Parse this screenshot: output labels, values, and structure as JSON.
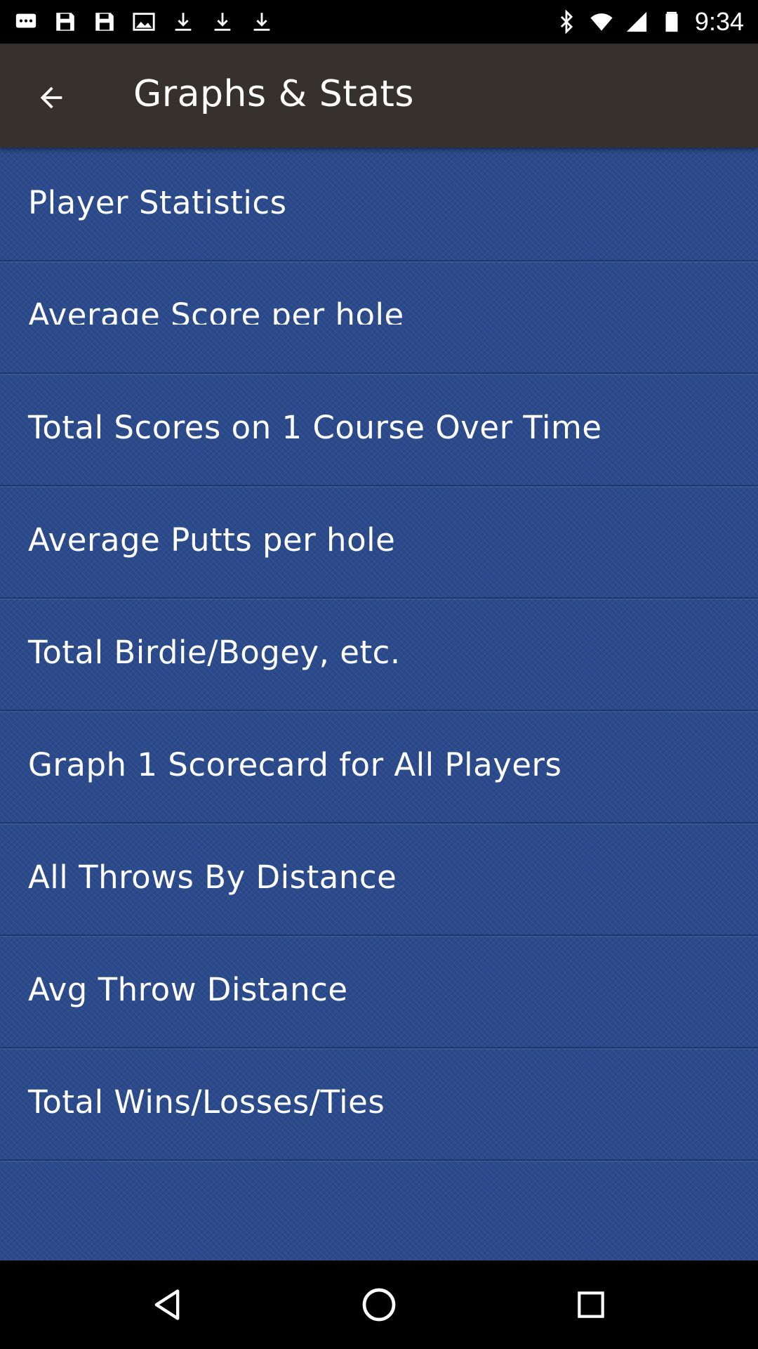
{
  "status_bar": {
    "time": "9:34",
    "left_icons": [
      "messages-icon",
      "save-icon",
      "save-icon",
      "image-icon",
      "download-icon",
      "download-icon",
      "download-icon"
    ],
    "right_icons": [
      "bluetooth-icon",
      "wifi-icon",
      "signal-icon",
      "battery-icon"
    ]
  },
  "app_bar": {
    "title": "Graphs & Stats"
  },
  "menu": {
    "items": [
      {
        "label": "Player Statistics"
      },
      {
        "label": "Average Score per hole"
      },
      {
        "label": "Total Scores on 1 Course Over Time"
      },
      {
        "label": "Average Putts per hole"
      },
      {
        "label": "Total Birdie/Bogey, etc."
      },
      {
        "label": "Graph 1 Scorecard for All Players"
      },
      {
        "label": "All Throws By Distance"
      },
      {
        "label": "Avg Throw Distance"
      },
      {
        "label": "Total Wins/Losses/Ties"
      }
    ]
  },
  "colors": {
    "app_bar": "#36312d",
    "content_bg": "#2a4a8b",
    "text": "#ffffff"
  }
}
